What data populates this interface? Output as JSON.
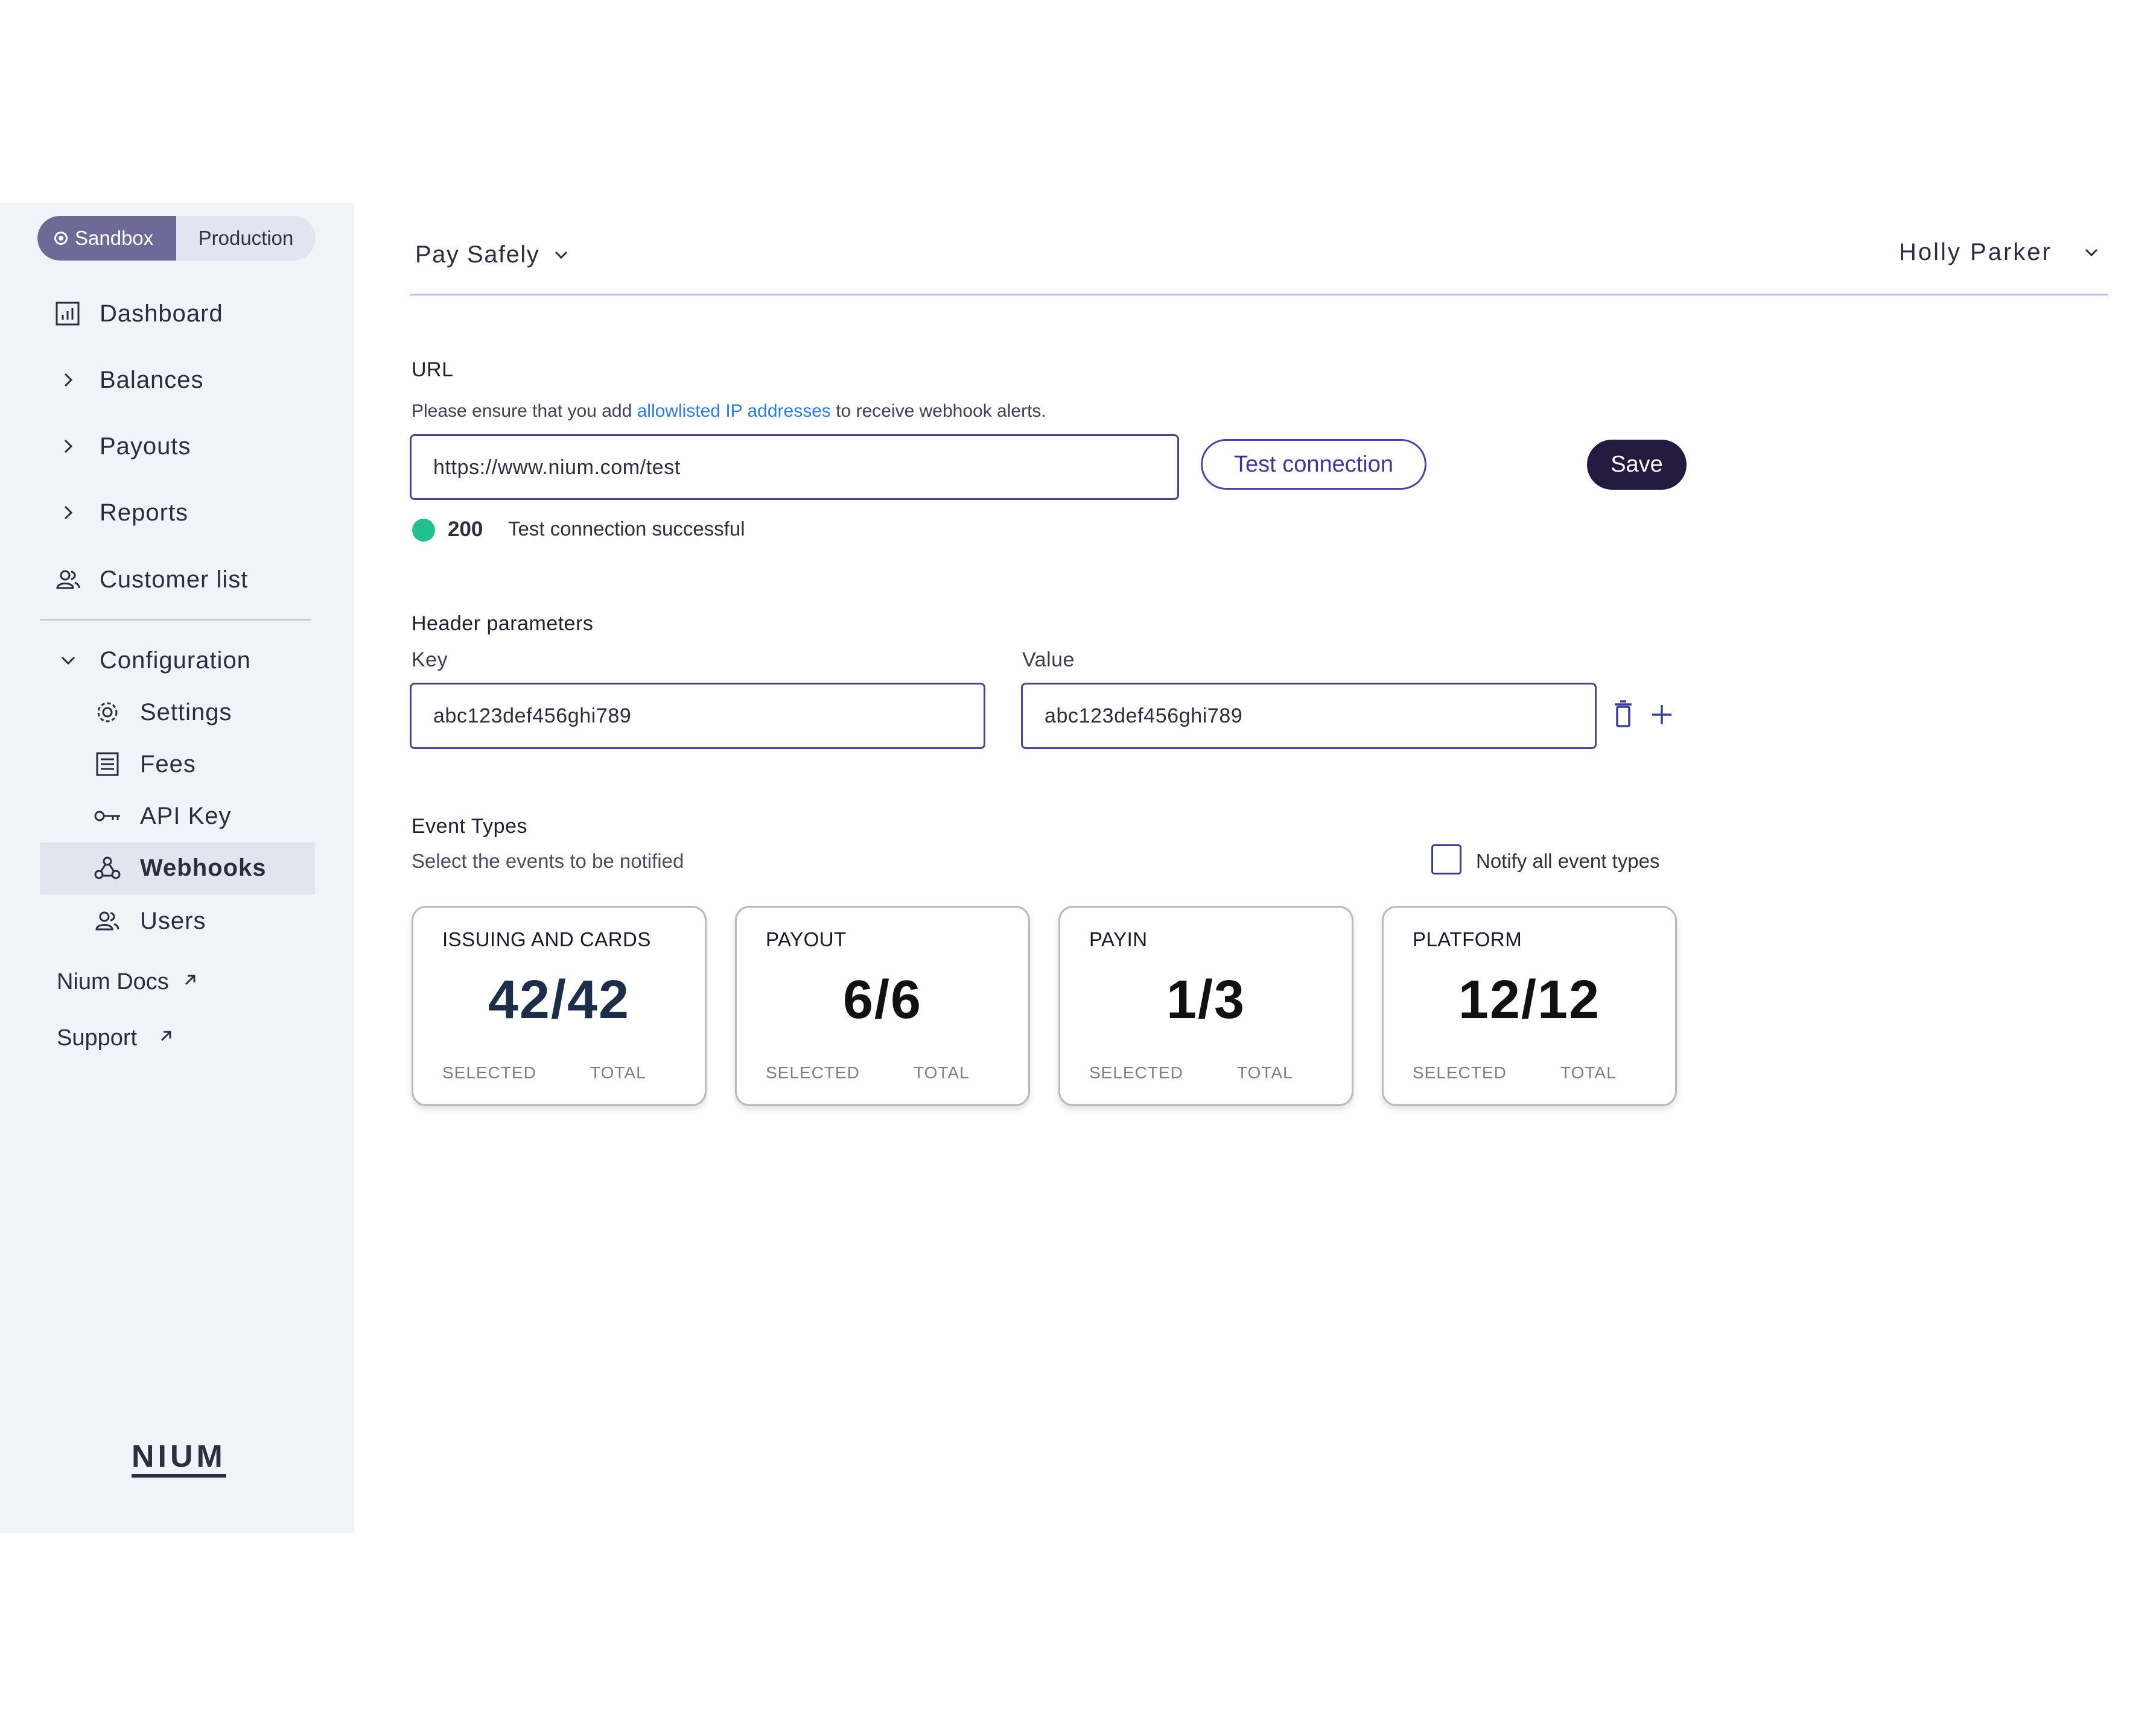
{
  "sidebar": {
    "env": {
      "sandbox": "Sandbox",
      "production": "Production"
    },
    "nav": {
      "dashboard": "Dashboard",
      "balances": "Balances",
      "payouts": "Payouts",
      "reports": "Reports",
      "customer_list": "Customer list",
      "configuration": "Configuration"
    },
    "config_items": {
      "settings": "Settings",
      "fees": "Fees",
      "api_key": "API Key",
      "webhooks": "Webhooks",
      "users": "Users"
    },
    "links": {
      "docs": "Nium Docs",
      "support": "Support"
    },
    "logo": "NIUM"
  },
  "header": {
    "org": "Pay Safely",
    "user": "Holly Parker"
  },
  "url_section": {
    "label": "URL",
    "help_prefix": "Please ensure that you add ",
    "help_link": "allowlisted IP addresses",
    "help_suffix": " to receive webhook alerts.",
    "value": "https://www.nium.com/test",
    "test_button": "Test connection",
    "save_button": "Save",
    "status_code": "200",
    "status_text": "Test connection successful"
  },
  "header_params": {
    "label": "Header parameters",
    "key_label": "Key",
    "value_label": "Value",
    "key_value": "abc123def456ghi789",
    "value_value": "abc123def456ghi789"
  },
  "event_types": {
    "label": "Event Types",
    "subtitle": "Select the events to be notified",
    "notify_all": "Notify all event types",
    "notify_all_checked": false,
    "selected_label": "SELECTED",
    "total_label": "TOTAL",
    "cards": [
      {
        "title": "ISSUING AND CARDS",
        "count": "42/42",
        "color": "#1d2e4b"
      },
      {
        "title": "PAYOUT",
        "count": "6/6",
        "color": "#111111"
      },
      {
        "title": "PAYIN",
        "count": "1/3",
        "color": "#111111"
      },
      {
        "title": "PLATFORM",
        "count": "12/12",
        "color": "#111111"
      }
    ]
  },
  "colors": {
    "accent": "#24193e",
    "sandbox": "#6d6a98",
    "success": "#20c18e",
    "link": "#2f7bd6"
  }
}
